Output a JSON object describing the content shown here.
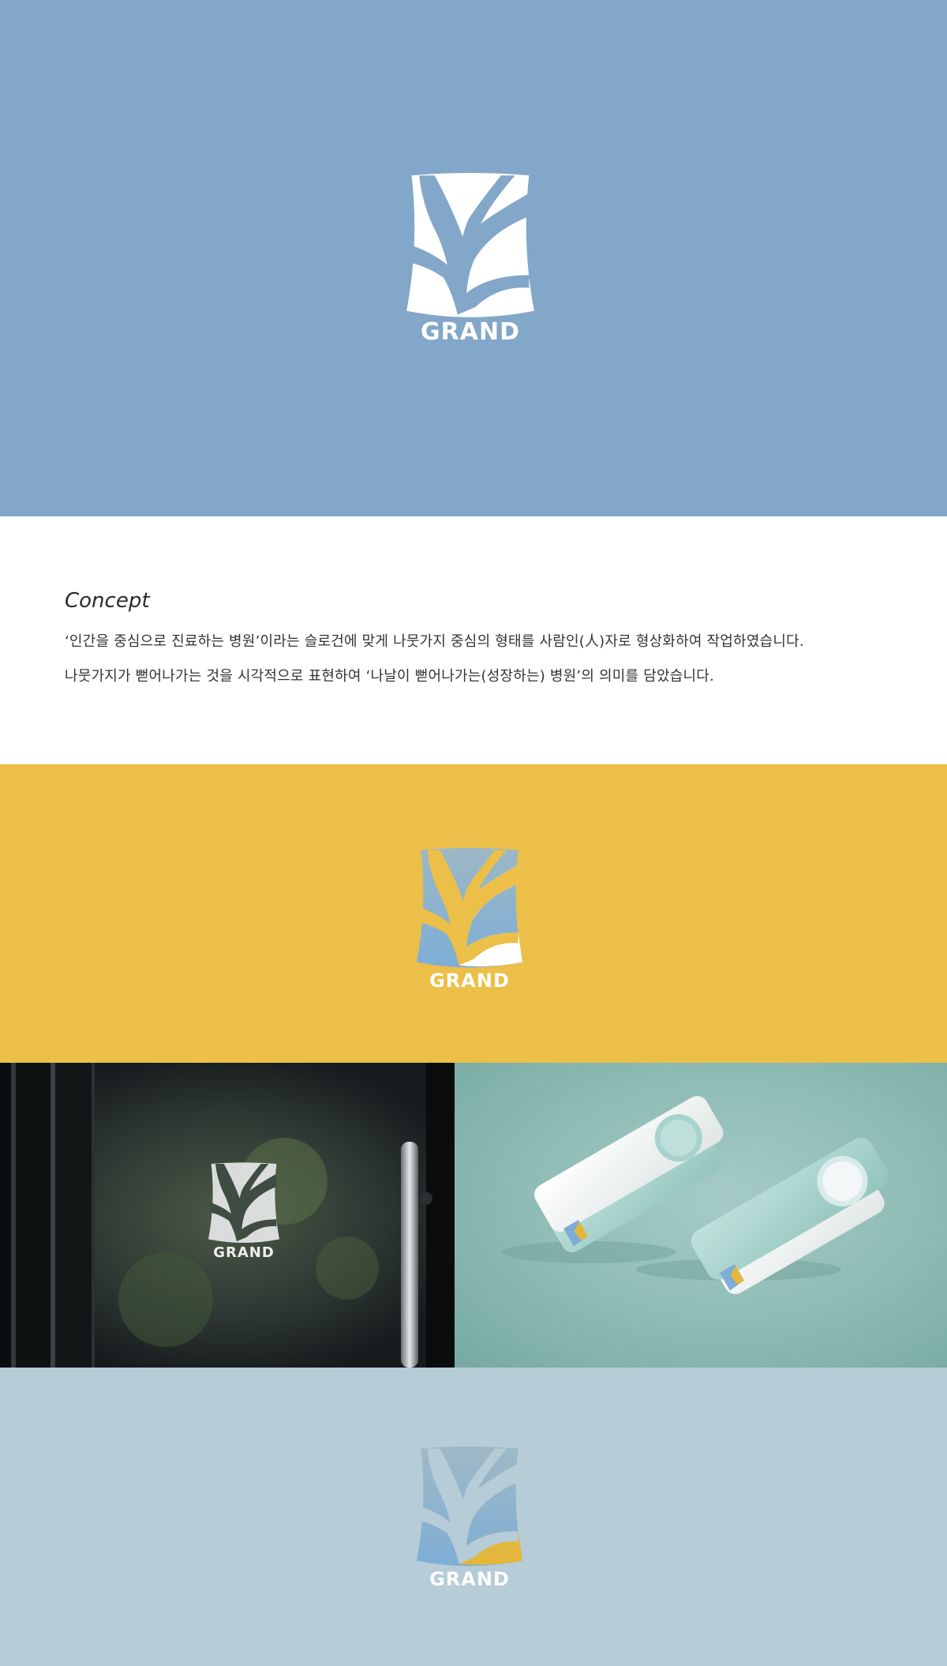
{
  "brand": {
    "wordmark": "GRAND"
  },
  "concept": {
    "title": "Concept",
    "lines": [
      "‘인간을 중심으로 진료하는 병원’이라는 슬로건에 맞게 나뭇가지 중심의 형태를 사람인(人)자로 형상화하여 작업하였습니다.",
      "나뭇가지가 뻗어나가는 것을 시각적으로 표현하여 ‘나날이 뻗어나가는(성장하는) 병원’의 의미를 담았습니다."
    ]
  },
  "colors": {
    "hero_bg": "#82a7c8",
    "yellow_bg": "#ecbf48",
    "pale_bg": "#b6ccd7",
    "logo_blue": "#7eaed6",
    "logo_yellow": "#e2b73c",
    "usb_teal": "#a8d3cc"
  },
  "icons": {
    "logo": "tree-branch-logo-icon",
    "usb": "usb-drive-icon"
  }
}
